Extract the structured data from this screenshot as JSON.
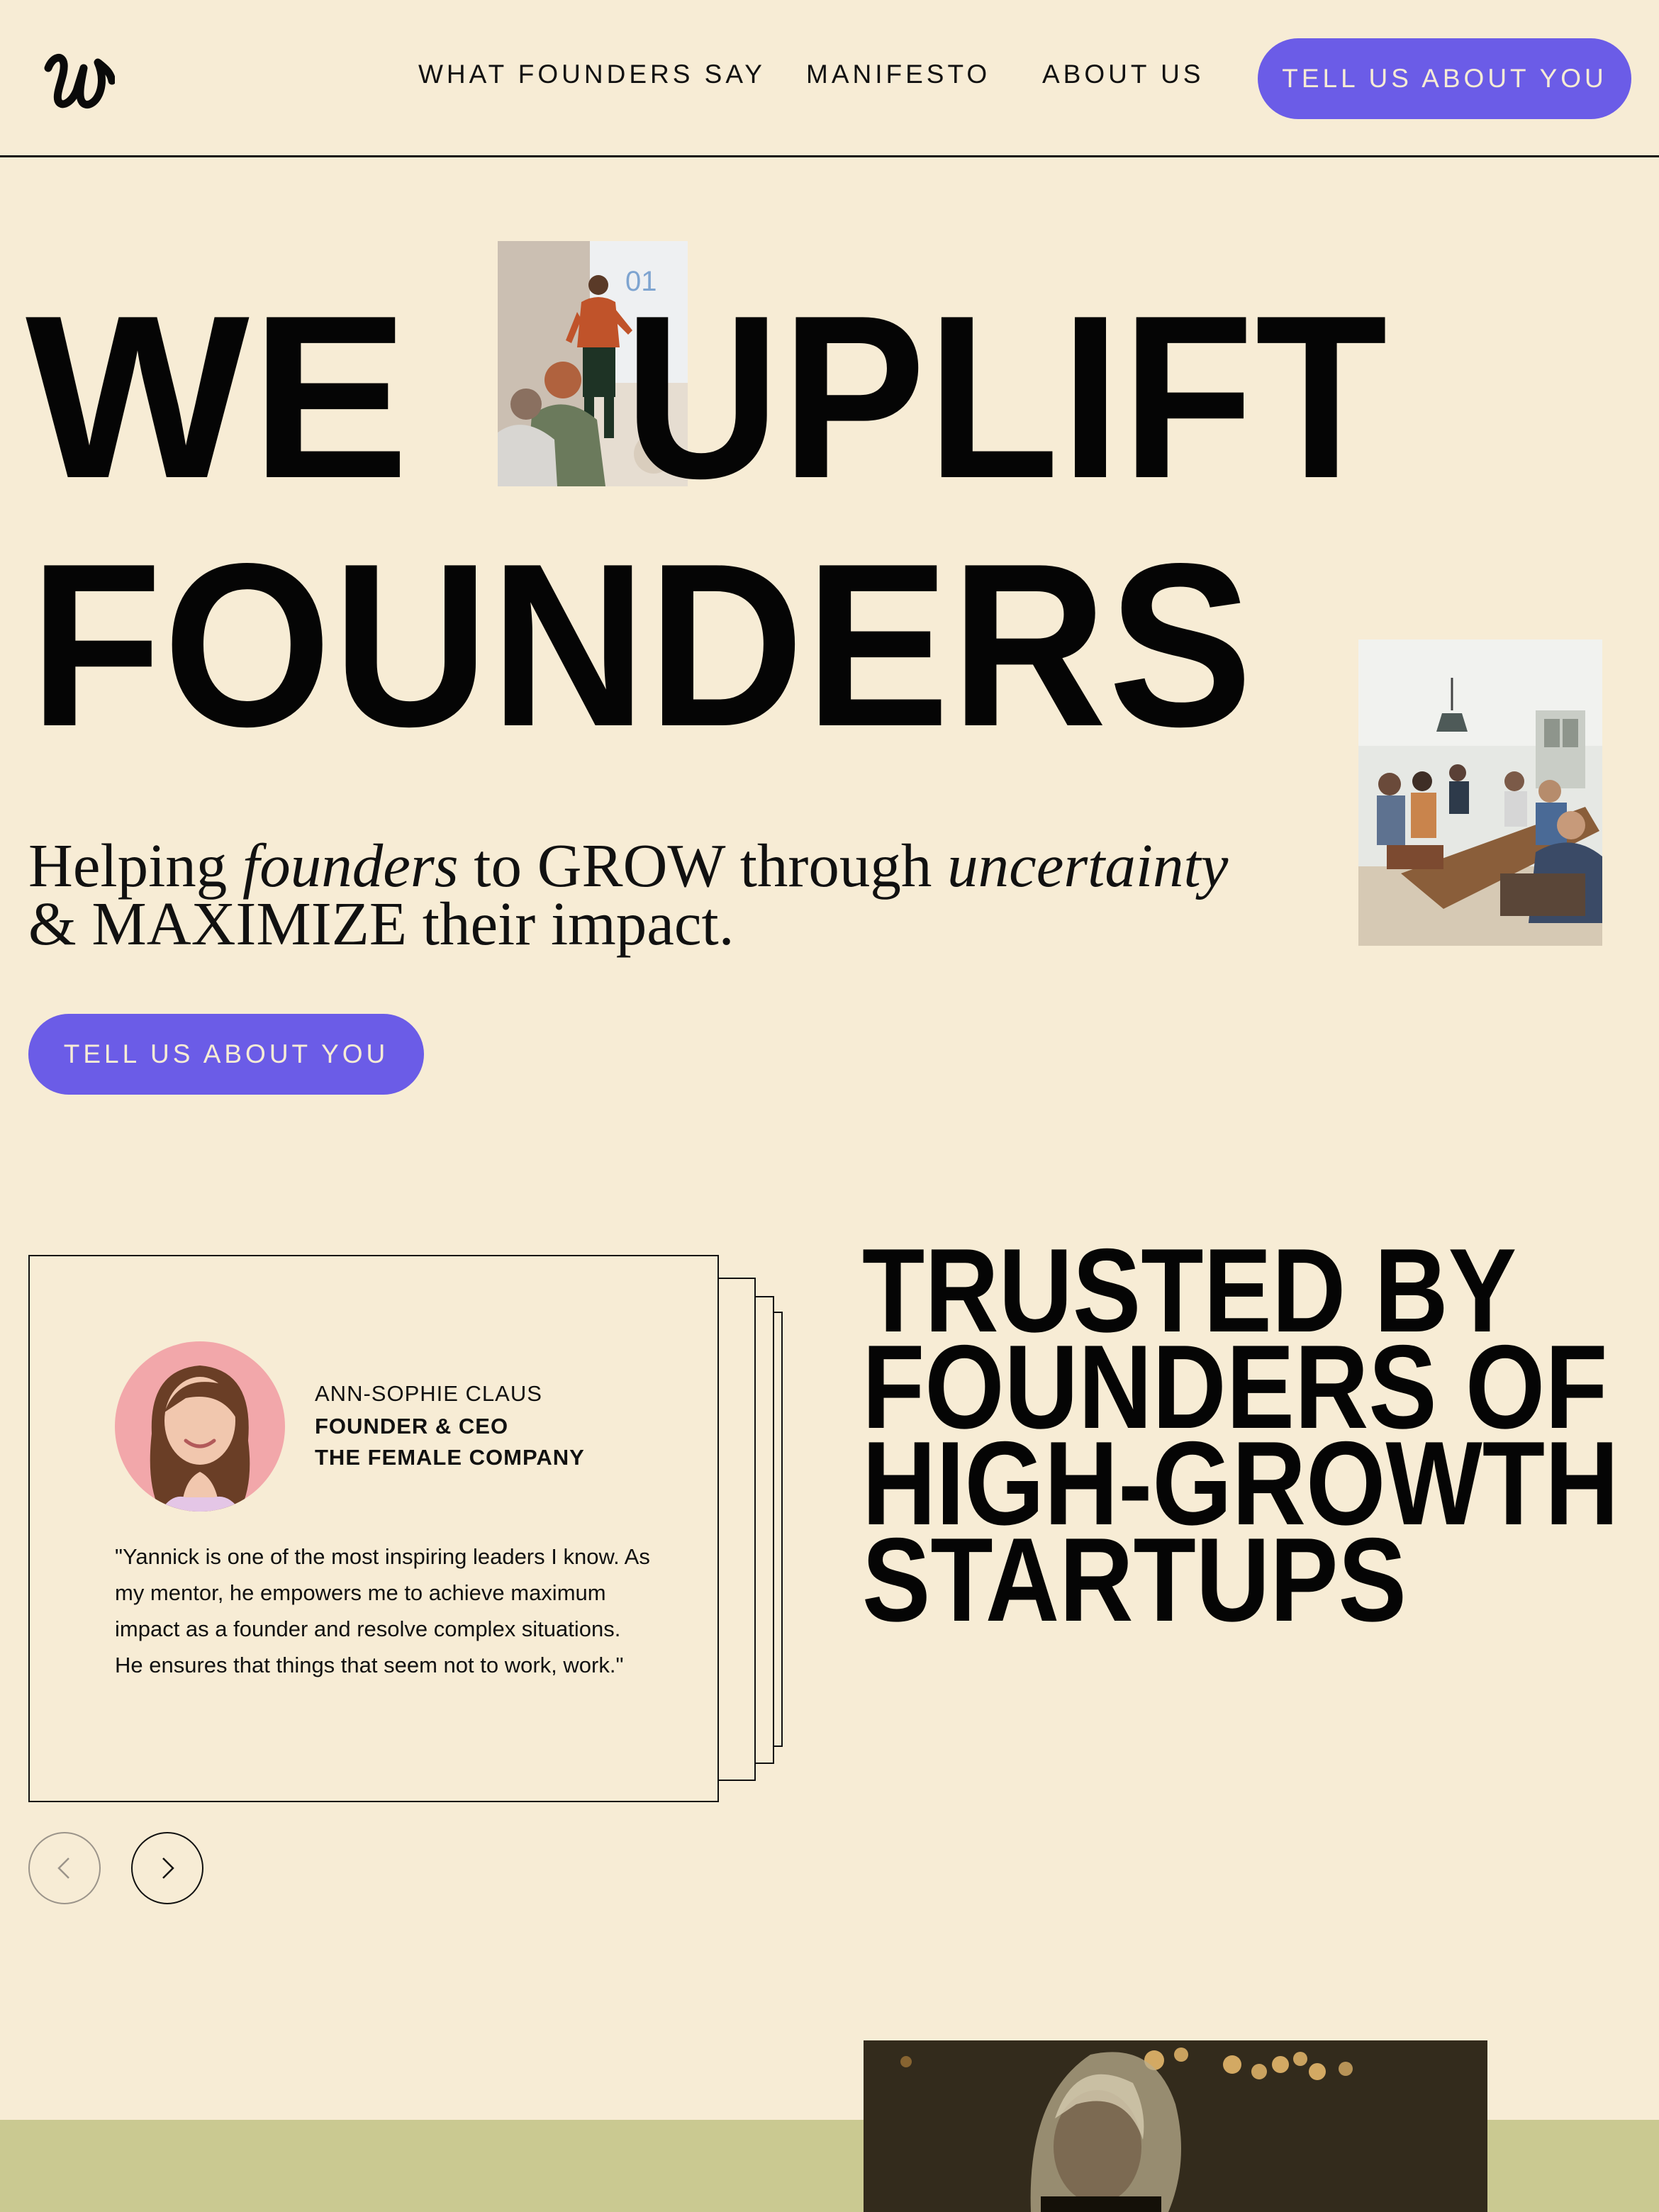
{
  "header": {
    "logo_alt": "u",
    "nav": [
      {
        "label": "WHAT FOUNDERS SAY"
      },
      {
        "label": "MANIFESTO"
      },
      {
        "label": "ABOUT US"
      }
    ],
    "cta_label": "TELL US ABOUT YOU"
  },
  "hero": {
    "title_words": [
      "WE",
      "UPLIFT",
      "FOUNDERS"
    ],
    "tagline": {
      "part1": "Helping ",
      "em1": "founders",
      "part2": " to GROW through ",
      "em2": "uncertainty",
      "part3": "& MAXIMIZE their impact."
    },
    "cta_label": "TELL US ABOUT YOU",
    "photo_slide_number": "01"
  },
  "testimonial": {
    "name": "ANN-SOPHIE CLAUS",
    "role": "FOUNDER & CEO",
    "company": "THE FEMALE COMPANY",
    "quote": "\"Yannick is one of the most inspiring leaders I know. As my mentor, he empowers me to achieve maximum impact as a founder and resolve complex situations. He ensures that things that seem not to work, work.\""
  },
  "trusted": {
    "lines": [
      "TRUSTED BY",
      "FOUNDERS OF",
      "HIGH-GROWTH",
      "STARTUPS"
    ]
  },
  "colors": {
    "background": "#f7ecd5",
    "accent": "#6b5ce7",
    "band": "#cac991",
    "text": "#0a0a0a"
  },
  "icons": {
    "logo": "brand-logo-icon",
    "prev": "chevron-left-icon",
    "next": "chevron-right-icon"
  }
}
